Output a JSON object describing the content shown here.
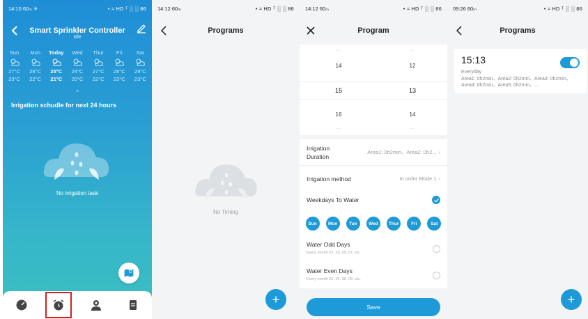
{
  "screen1": {
    "status_time": "14:10",
    "status_left_extra": "60ₘ ✳",
    "status_right": "• ≈ HD ᵀ ░ ░ 86",
    "title": "Smart Sprinkler Controller",
    "subtitle": "Idle",
    "days": [
      {
        "name": "Sun",
        "high": "27°C",
        "low": "23°C"
      },
      {
        "name": "Mon",
        "high": "26°C",
        "low": "22°C"
      },
      {
        "name": "Today",
        "high": "25°C",
        "low": "21°C"
      },
      {
        "name": "Wed",
        "high": "24°C",
        "low": "20°C"
      },
      {
        "name": "Thur",
        "high": "27°C",
        "low": "22°C"
      },
      {
        "name": "Fri",
        "high": "28°C",
        "low": "23°C"
      },
      {
        "name": "Sat",
        "high": "29°C",
        "low": "23°C"
      }
    ],
    "schedule_heading": "Irrigation schudle for next 24 hours",
    "empty_text": "No irrigation task",
    "nav": [
      "dashboard-icon",
      "alarm-clock-icon",
      "user-icon",
      "document-icon"
    ]
  },
  "screen2": {
    "status_time": "14:12",
    "status_left_extra": "60ₘ",
    "title": "Programs",
    "empty_text": "No Timing",
    "add_label": "+"
  },
  "screen3": {
    "status_time": "14:12",
    "status_left_extra": "60ₘ",
    "title": "Program",
    "picker_hours": [
      "14",
      "15",
      "16"
    ],
    "picker_minutes": [
      "12",
      "13",
      "14"
    ],
    "picker_dim": "- -",
    "duration_label": "Irrigation Duration",
    "duration_value": "Area1: 0h2min、Area2: 0h2...",
    "method_label": "Irrigation method",
    "method_value": "In order Mode 1",
    "weekdays_label": "Weekdays To Water",
    "weekdays": [
      "Sun",
      "Mon",
      "Tue",
      "Wed",
      "Thur",
      "Fri",
      "Sat"
    ],
    "odd_label": "Water Odd Days",
    "odd_sub": "Every month 01, 03, 05, 07, etc.",
    "even_label": "Water Even Days",
    "even_sub": "Every month 02, 04, 06, 08, etc.",
    "save_label": "Save"
  },
  "screen4": {
    "status_time": "09:26",
    "status_left_extra": "60ₘ",
    "title": "Programs",
    "program_time": "15:13",
    "program_repeat": "Everyday",
    "program_areas": "Area1: 0h2min、Area2: 0h2min、Area3: 0h2min、Area4: 0h2min、Area5: 0h2min、...",
    "add_label": "+"
  },
  "colors": {
    "accent": "#1e9ad8",
    "highlight": "#d81e1e"
  }
}
